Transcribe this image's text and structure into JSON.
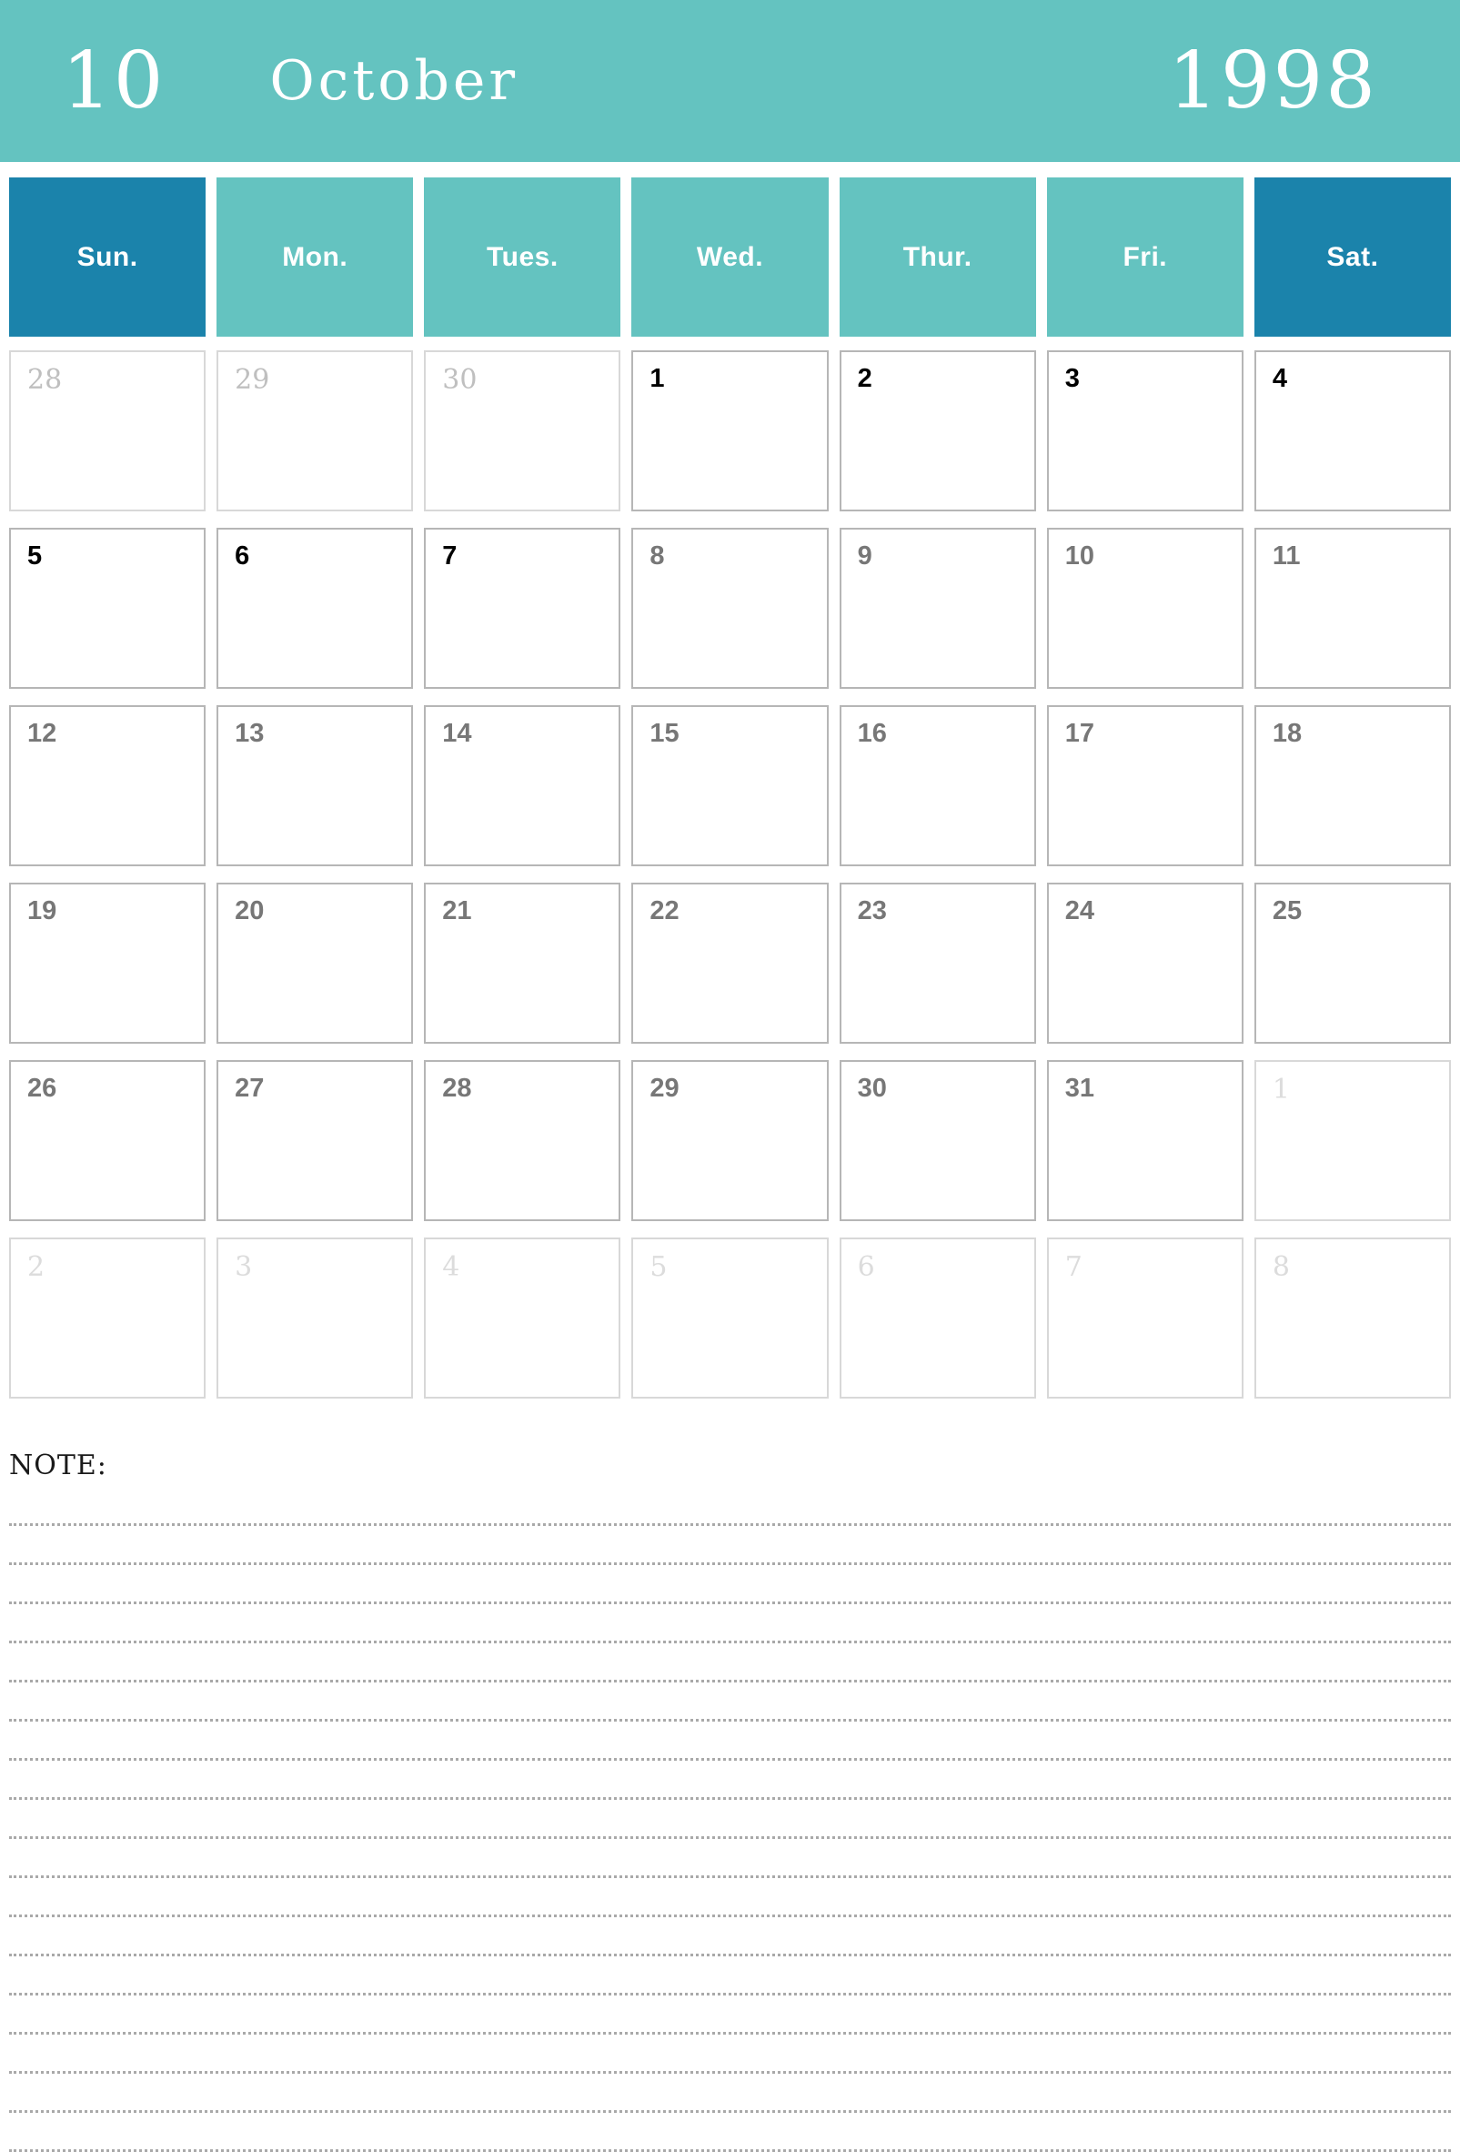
{
  "banner": {
    "month_number": "10",
    "month_name": "October",
    "year": "1998",
    "background_color": "#64c3c0",
    "text_color": "#ffffff"
  },
  "weekdays": [
    {
      "label": "Sun.",
      "weekend": true,
      "color": "#1b83ab"
    },
    {
      "label": "Mon.",
      "weekend": false,
      "color": "#64c3c0"
    },
    {
      "label": "Tues.",
      "weekend": false,
      "color": "#64c3c0"
    },
    {
      "label": "Wed.",
      "weekend": false,
      "color": "#64c3c0"
    },
    {
      "label": "Thur.",
      "weekend": false,
      "color": "#64c3c0"
    },
    {
      "label": "Fri.",
      "weekend": false,
      "color": "#64c3c0"
    },
    {
      "label": "Sat.",
      "weekend": true,
      "color": "#1b83ab"
    }
  ],
  "weeks": [
    [
      {
        "day": "28",
        "style": "muted"
      },
      {
        "day": "29",
        "style": "muted"
      },
      {
        "day": "30",
        "style": "muted"
      },
      {
        "day": "1",
        "style": "emphasis"
      },
      {
        "day": "2",
        "style": "emphasis"
      },
      {
        "day": "3",
        "style": "emphasis"
      },
      {
        "day": "4",
        "style": "emphasis"
      }
    ],
    [
      {
        "day": "5",
        "style": "emphasis"
      },
      {
        "day": "6",
        "style": "emphasis"
      },
      {
        "day": "7",
        "style": "emphasis"
      },
      {
        "day": "8",
        "style": "normal"
      },
      {
        "day": "9",
        "style": "normal"
      },
      {
        "day": "10",
        "style": "normal"
      },
      {
        "day": "11",
        "style": "normal"
      }
    ],
    [
      {
        "day": "12",
        "style": "normal"
      },
      {
        "day": "13",
        "style": "normal"
      },
      {
        "day": "14",
        "style": "normal"
      },
      {
        "day": "15",
        "style": "normal"
      },
      {
        "day": "16",
        "style": "normal"
      },
      {
        "day": "17",
        "style": "normal"
      },
      {
        "day": "18",
        "style": "normal"
      }
    ],
    [
      {
        "day": "19",
        "style": "normal"
      },
      {
        "day": "20",
        "style": "normal"
      },
      {
        "day": "21",
        "style": "normal"
      },
      {
        "day": "22",
        "style": "normal"
      },
      {
        "day": "23",
        "style": "normal"
      },
      {
        "day": "24",
        "style": "normal"
      },
      {
        "day": "25",
        "style": "normal"
      }
    ],
    [
      {
        "day": "26",
        "style": "normal"
      },
      {
        "day": "27",
        "style": "normal"
      },
      {
        "day": "28",
        "style": "normal"
      },
      {
        "day": "29",
        "style": "normal"
      },
      {
        "day": "30",
        "style": "normal"
      },
      {
        "day": "31",
        "style": "normal"
      },
      {
        "day": "1",
        "style": "muted-faint"
      }
    ],
    [
      {
        "day": "2",
        "style": "muted-faint"
      },
      {
        "day": "3",
        "style": "muted-faint"
      },
      {
        "day": "4",
        "style": "muted-faint"
      },
      {
        "day": "5",
        "style": "muted-faint"
      },
      {
        "day": "6",
        "style": "muted-faint"
      },
      {
        "day": "7",
        "style": "muted-faint"
      },
      {
        "day": "8",
        "style": "muted-faint"
      }
    ]
  ],
  "note": {
    "title": "NOTE:",
    "line_count": 17
  }
}
